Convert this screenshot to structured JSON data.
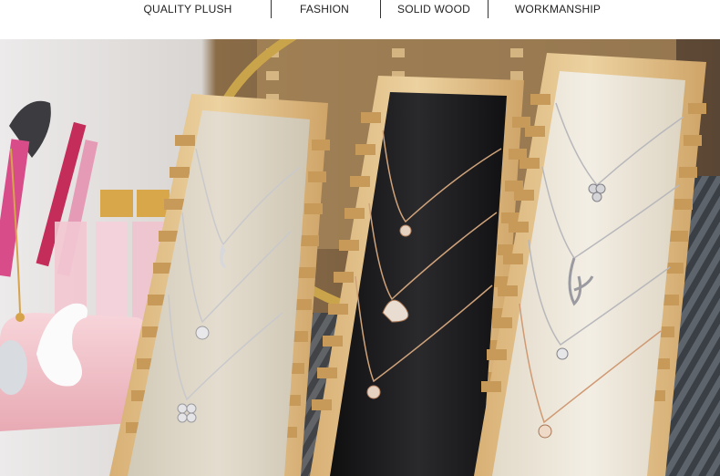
{
  "features": [
    {
      "label": "QUALITY PLUSH"
    },
    {
      "label": "FASHION"
    },
    {
      "label": "SOLID WOOD"
    },
    {
      "label": "WORKMANSHIP"
    }
  ],
  "photo": {
    "subject": "necklace-display-boards",
    "colors": {
      "wood": "#e6c48a",
      "wood_dark": "#c79a5a",
      "panel_beige": "#ddd6c6",
      "panel_black": "#1b1b1d",
      "panel_cream": "#eee7d8",
      "mirror_gold": "#c9a44a",
      "tray_pink": "#f3c9cf",
      "chain_silver": "#c9c9cc",
      "chain_rose": "#c98b6a"
    }
  }
}
